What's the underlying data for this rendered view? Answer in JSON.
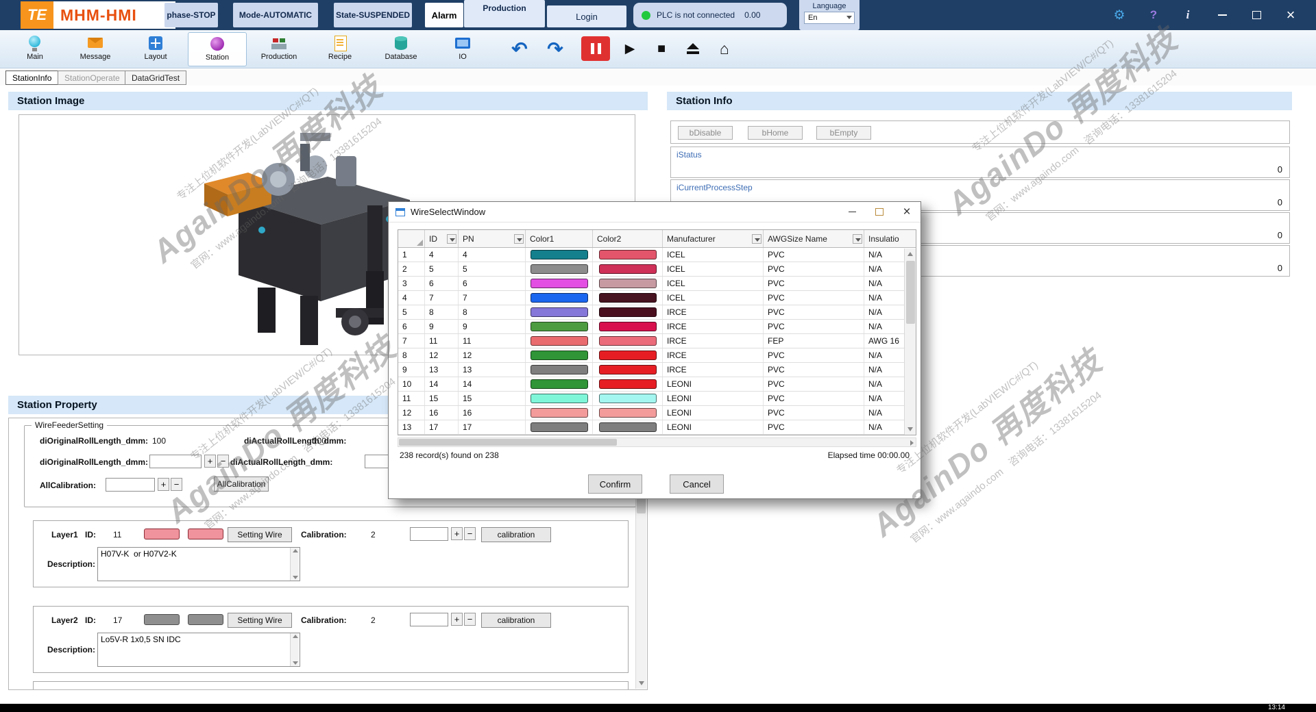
{
  "titlebar": {
    "logo": "TE",
    "app_title": "MHM-HMI",
    "phase_button": "phase-STOP",
    "mode_button": "Mode-AUTOMATIC",
    "state_button": "State-SUSPENDED",
    "alarm_button": "Alarm",
    "production_button": "Production",
    "login_button": "Login",
    "plc_status": "PLC is not connected",
    "plc_value": "0.00",
    "language_label": "Language",
    "language_value": "En"
  },
  "toolbar": {
    "items": [
      {
        "label": "Main",
        "icon": "bulb-icon"
      },
      {
        "label": "Message",
        "icon": "mail-icon"
      },
      {
        "label": "Layout",
        "icon": "layout-icon"
      },
      {
        "label": "Station",
        "icon": "station-icon"
      },
      {
        "label": "Production",
        "icon": "production-icon"
      },
      {
        "label": "Recipe",
        "icon": "recipe-icon"
      },
      {
        "label": "Database",
        "icon": "database-icon"
      },
      {
        "label": "IO",
        "icon": "io-icon"
      }
    ]
  },
  "tabs": [
    {
      "label": "StationInfo"
    },
    {
      "label": "StationOperate"
    },
    {
      "label": "DataGridTest"
    }
  ],
  "station_image": {
    "title": "Station Image"
  },
  "station_info": {
    "title": "Station Info",
    "buttons": [
      "bDisable",
      "bHome",
      "bEmpty"
    ],
    "fields": [
      {
        "label": "iStatus",
        "value": "0"
      },
      {
        "label": "iCurrentProcessStep",
        "value": "0"
      },
      {
        "label": "",
        "value": "0"
      },
      {
        "label": "",
        "value": "0"
      }
    ]
  },
  "station_property": {
    "title": "Station Property",
    "group_title": "WireFeederSetting",
    "plus": "+",
    "minus": "−",
    "row1": {
      "label1": "diOriginalRollLength_dmm:",
      "value1": "100",
      "label2": "diActualRollLength_dmm:",
      "value2": "100"
    },
    "row2": {
      "label1": "diOriginalRollLength_dmm:",
      "label2": "diActualRollLength_dmm:"
    },
    "row3": {
      "label": "AllCalibration:",
      "button": "AllCalibration"
    },
    "layers": [
      {
        "name": "Layer1",
        "id_label": "ID:",
        "id": "11",
        "swatch": "#f0939c",
        "swatch_border": "#8b2a35",
        "setting_button": "Setting Wire",
        "cal_label": "Calibration:",
        "cal_value": "2",
        "cal_button": "calibration",
        "desc_label": "Description:",
        "description": "H07V-K  or H07V2-K"
      },
      {
        "name": "Layer2",
        "id_label": "ID:",
        "id": "17",
        "swatch": "#8f8f8f",
        "swatch_border": "#4d4d4d",
        "setting_button": "Setting Wire",
        "cal_label": "Calibration:",
        "cal_value": "2",
        "cal_button": "calibration",
        "desc_label": "Description:",
        "description": "Lo5V-R 1x0,5 SN IDC"
      }
    ]
  },
  "dialog": {
    "title": "WireSelectWindow",
    "columns": [
      "",
      "ID",
      "PN",
      "Color1",
      "Color2",
      "Manufacturer",
      "AWGSize Name",
      "Insulatio"
    ],
    "rows": [
      {
        "num": "1",
        "id": "4",
        "pn": "4",
        "color1": "#15808d",
        "color2": "#e2556b",
        "manufacturer": "ICEL",
        "awg": "PVC",
        "insulation": "N/A"
      },
      {
        "num": "2",
        "id": "5",
        "pn": "5",
        "color1": "#8c8c8c",
        "color2": "#cf3057",
        "manufacturer": "ICEL",
        "awg": "PVC",
        "insulation": "N/A"
      },
      {
        "num": "3",
        "id": "6",
        "pn": "6",
        "color1": "#e24fe2",
        "color2": "#c79aa2",
        "manufacturer": "ICEL",
        "awg": "PVC",
        "insulation": "N/A"
      },
      {
        "num": "4",
        "id": "7",
        "pn": "7",
        "color1": "#1b66ee",
        "color2": "#471320",
        "manufacturer": "ICEL",
        "awg": "PVC",
        "insulation": "N/A"
      },
      {
        "num": "5",
        "id": "8",
        "pn": "8",
        "color1": "#8577d9",
        "color2": "#4a0f1f",
        "manufacturer": "IRCE",
        "awg": "PVC",
        "insulation": "N/A"
      },
      {
        "num": "6",
        "id": "9",
        "pn": "9",
        "color1": "#4d9c40",
        "color2": "#d8114e",
        "manufacturer": "IRCE",
        "awg": "PVC",
        "insulation": "N/A"
      },
      {
        "num": "7",
        "id": "11",
        "pn": "11",
        "color1": "#ea6b6e",
        "color2": "#eb6b7a",
        "manufacturer": "IRCE",
        "awg": "FEP",
        "insulation": "AWG 16"
      },
      {
        "num": "8",
        "id": "12",
        "pn": "12",
        "color1": "#2f9537",
        "color2": "#e61e24",
        "manufacturer": "IRCE",
        "awg": "PVC",
        "insulation": "N/A"
      },
      {
        "num": "9",
        "id": "13",
        "pn": "13",
        "color1": "#7e7e7e",
        "color2": "#e61e24",
        "manufacturer": "IRCE",
        "awg": "PVC",
        "insulation": "N/A"
      },
      {
        "num": "10",
        "id": "14",
        "pn": "14",
        "color1": "#2f9537",
        "color2": "#e61e24",
        "manufacturer": "LEONI",
        "awg": "PVC",
        "insulation": "N/A"
      },
      {
        "num": "11",
        "id": "15",
        "pn": "15",
        "color1": "#80f6d9",
        "color2": "#a4f6f0",
        "manufacturer": "LEONI",
        "awg": "PVC",
        "insulation": "N/A"
      },
      {
        "num": "12",
        "id": "16",
        "pn": "16",
        "color1": "#f39b9b",
        "color2": "#f39b9b",
        "manufacturer": "LEONI",
        "awg": "PVC",
        "insulation": "N/A"
      },
      {
        "num": "13",
        "id": "17",
        "pn": "17",
        "color1": "#7e7e7e",
        "color2": "#7e7e7e",
        "manufacturer": "LEONI",
        "awg": "PVC",
        "insulation": "N/A"
      }
    ],
    "status_left": "238 record(s) found on 238",
    "status_right": "Elapsed time 00:00.00",
    "confirm_button": "Confirm",
    "cancel_button": "Cancel"
  },
  "watermark": {
    "line_top": "专注上位机软件开发(LabVIEW/C#/QT)",
    "brand": "AgainDo 再度科技",
    "line_bottom": "官网：www.againdo.com　咨询电话：13381615204"
  },
  "statusbar": {
    "time": "13:14"
  },
  "colors": {
    "titlebar_bg": "#1f3f66",
    "brand_orange": "#f7941d",
    "title_red": "#e8500f",
    "section_header_bg": "#d5e7f8",
    "plc_green": "#21c93f",
    "pause_red": "#e03131",
    "field_label_blue": "#3c6cb4"
  }
}
